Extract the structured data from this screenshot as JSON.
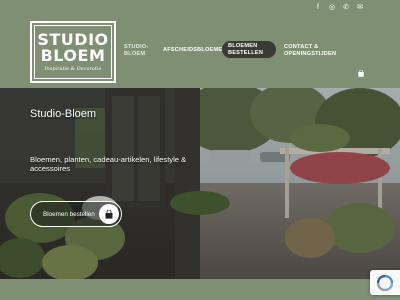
{
  "topbar": {
    "social": [
      {
        "icon": "facebook-icon",
        "glyph": "f"
      },
      {
        "icon": "instagram-icon",
        "glyph": "◎"
      },
      {
        "icon": "phone-icon",
        "glyph": "✆"
      },
      {
        "icon": "email-icon",
        "glyph": "✉"
      }
    ]
  },
  "logo": {
    "line1": "STUDIO",
    "line2": "BLOEM",
    "tagline": "Inspiratie & Decoratie"
  },
  "nav": {
    "items": [
      {
        "label": "STUDIO-BLOEM",
        "active": true
      },
      {
        "label": "AFSCHEIDSBLOEMEN"
      },
      {
        "label": "BLOEMEN BESTELLEN",
        "highlighted": true
      },
      {
        "label": "CONTACT & OPENINGSTIJDEN"
      }
    ],
    "cart_icon": "shopping-bag-icon"
  },
  "hero": {
    "title": "Studio-Bloem",
    "subtitle": "Bloemen, planten, cadeau-artikelen, lifestyle & accessoires",
    "button_label": "Bloemen bestellen",
    "button_icon": "shopping-bag-icon"
  },
  "recaptcha": {
    "icon": "recaptcha-icon"
  },
  "colors": {
    "brand_green": "#7f8f74",
    "nav_highlight": "#3a3b36",
    "white": "#ffffff"
  }
}
